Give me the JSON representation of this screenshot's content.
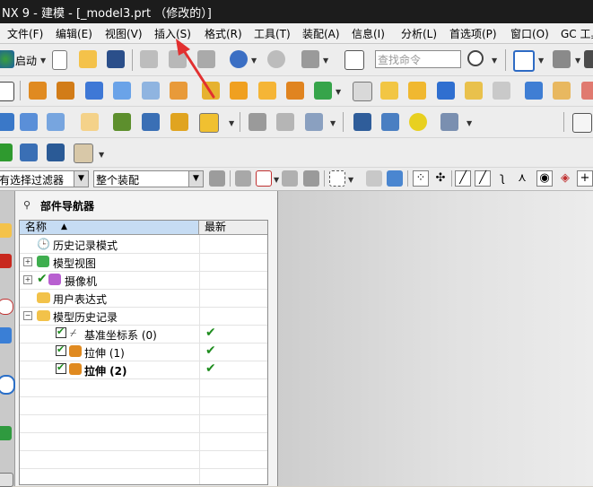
{
  "window": {
    "title": "NX 9 - 建模 - [_model3.prt （修改的）]"
  },
  "menubar": [
    {
      "id": "file",
      "label": "文件(F)"
    },
    {
      "id": "edit",
      "label": "编辑(E)"
    },
    {
      "id": "view",
      "label": "视图(V)"
    },
    {
      "id": "insert",
      "label": "插入(S)"
    },
    {
      "id": "format",
      "label": "格式(R)"
    },
    {
      "id": "tools",
      "label": "工具(T)"
    },
    {
      "id": "assembly",
      "label": "装配(A)"
    },
    {
      "id": "info",
      "label": "信息(I)"
    },
    {
      "id": "analysis",
      "label": "分析(L)"
    },
    {
      "id": "preferences",
      "label": "首选项(P)"
    },
    {
      "id": "window",
      "label": "窗口(O)"
    },
    {
      "id": "gc",
      "label": "GC 工具"
    }
  ],
  "toolbar": {
    "start_label": "启动",
    "search_placeholder": "查找命令"
  },
  "selection_bar": {
    "filter_value": "有选择过滤器",
    "scope_value": "整个装配"
  },
  "part_navigator": {
    "title": "部件导航器",
    "columns": {
      "name": "名称",
      "latest": "最新"
    },
    "rows": [
      {
        "label": "历史记录模式",
        "latest": "",
        "checked": null
      },
      {
        "label": "模型视图",
        "latest": "",
        "checked": null
      },
      {
        "label": "摄像机",
        "latest": "",
        "checked": null
      },
      {
        "label": "用户表达式",
        "latest": "",
        "checked": null
      },
      {
        "label": "模型历史记录",
        "latest": "",
        "checked": null
      },
      {
        "label": "基准坐标系 (0)",
        "latest": "✔",
        "checked": true
      },
      {
        "label": "拉伸 (1)",
        "latest": "✔",
        "checked": true
      },
      {
        "label": "拉伸 (2)",
        "latest": "✔",
        "checked": true
      }
    ]
  },
  "colors": {
    "annotation_arrow": "#e23030",
    "check_green": "#1e8c1e",
    "header_blue": "#c6dcf3"
  }
}
